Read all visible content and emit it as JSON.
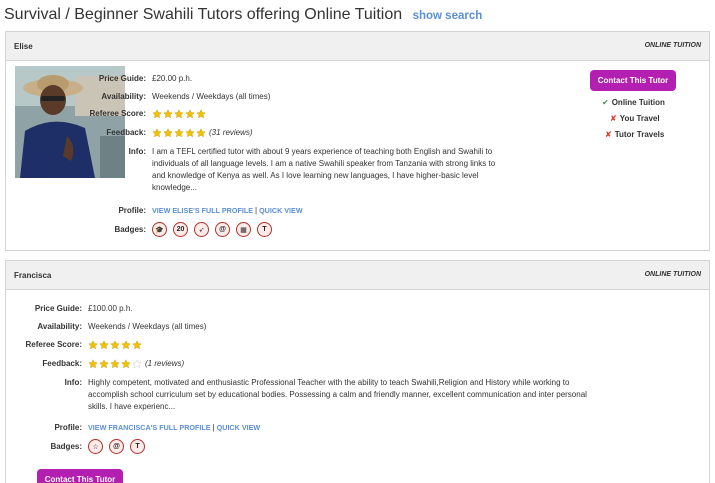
{
  "page": {
    "title": "Survival / Beginner Swahili Tutors offering Online Tuition",
    "show_search": "show search"
  },
  "labels": {
    "price": "Price Guide:",
    "availability": "Availability:",
    "referee": "Referee Score:",
    "feedback": "Feedback:",
    "info": "Info:",
    "profile": "Profile:",
    "badges": "Badges:",
    "separator": "|"
  },
  "tutors": [
    {
      "name": "Elise",
      "tuition_mode": "ONLINE TUITION",
      "price": "£20.00 p.h.",
      "availability": "Weekends / Weekdays (all times)",
      "referee_score": 5,
      "feedback_score": 5,
      "feedback_reviews": "(31 reviews)",
      "info": "I am a TEFL certified tutor with about 9 years experience of teaching both English and Swahili to individuals of all language levels. I am a native Swahili speaker from Tanzania with strong links to and knowledge of Kenya as well. As I love learning new languages, I have higher-basic level knowledge...",
      "profile_link": "VIEW ELISE'S FULL PROFILE",
      "quick_view": "QUICK VIEW",
      "badges": [
        {
          "icon": "graduation-cap-icon",
          "glyph": "🎓"
        },
        {
          "icon": "twenty-hours-icon",
          "glyph": "20"
        },
        {
          "icon": "rocket-icon",
          "glyph": "➶"
        },
        {
          "icon": "at-sign-icon",
          "glyph": "@"
        },
        {
          "icon": "calendar-icon",
          "glyph": "▦"
        },
        {
          "icon": "t-tutor-icon",
          "glyph": "T"
        }
      ],
      "contact_label": "Contact This Tutor",
      "features": [
        {
          "label": "Online Tuition",
          "available": true
        },
        {
          "label": "You Travel",
          "available": false
        },
        {
          "label": "Tutor Travels",
          "available": false
        }
      ]
    },
    {
      "name": "Francisca",
      "tuition_mode": "ONLINE TUITION",
      "price": "£100.00 p.h.",
      "availability": "Weekends / Weekdays (all times)",
      "referee_score": 5,
      "feedback_score": 4,
      "feedback_reviews": "(1 reviews)",
      "info": "Highly competent, motivated and enthusiastic Professional Teacher with the ability to teach Swahili,Religion and History while working to accomplish school curriculum set by educational bodies. Possessing a calm and friendly manner, excellent communication and inter personal skills. I have experienc...",
      "profile_link": "VIEW FRANCISCA'S FULL PROFILE",
      "quick_view": "QUICK VIEW",
      "badges": [
        {
          "icon": "star-badge-icon",
          "glyph": "☆"
        },
        {
          "icon": "at-sign-icon",
          "glyph": "@"
        },
        {
          "icon": "t-tutor-icon",
          "glyph": "T"
        }
      ],
      "contact_label": "Contact This Tutor"
    }
  ],
  "colors": {
    "accent_purple": "#b31fb0",
    "link_blue": "#5a8fd6",
    "star_gold": "#f2c200",
    "tick_green": "#3b9b3a",
    "cross_red": "#d13b2e"
  }
}
